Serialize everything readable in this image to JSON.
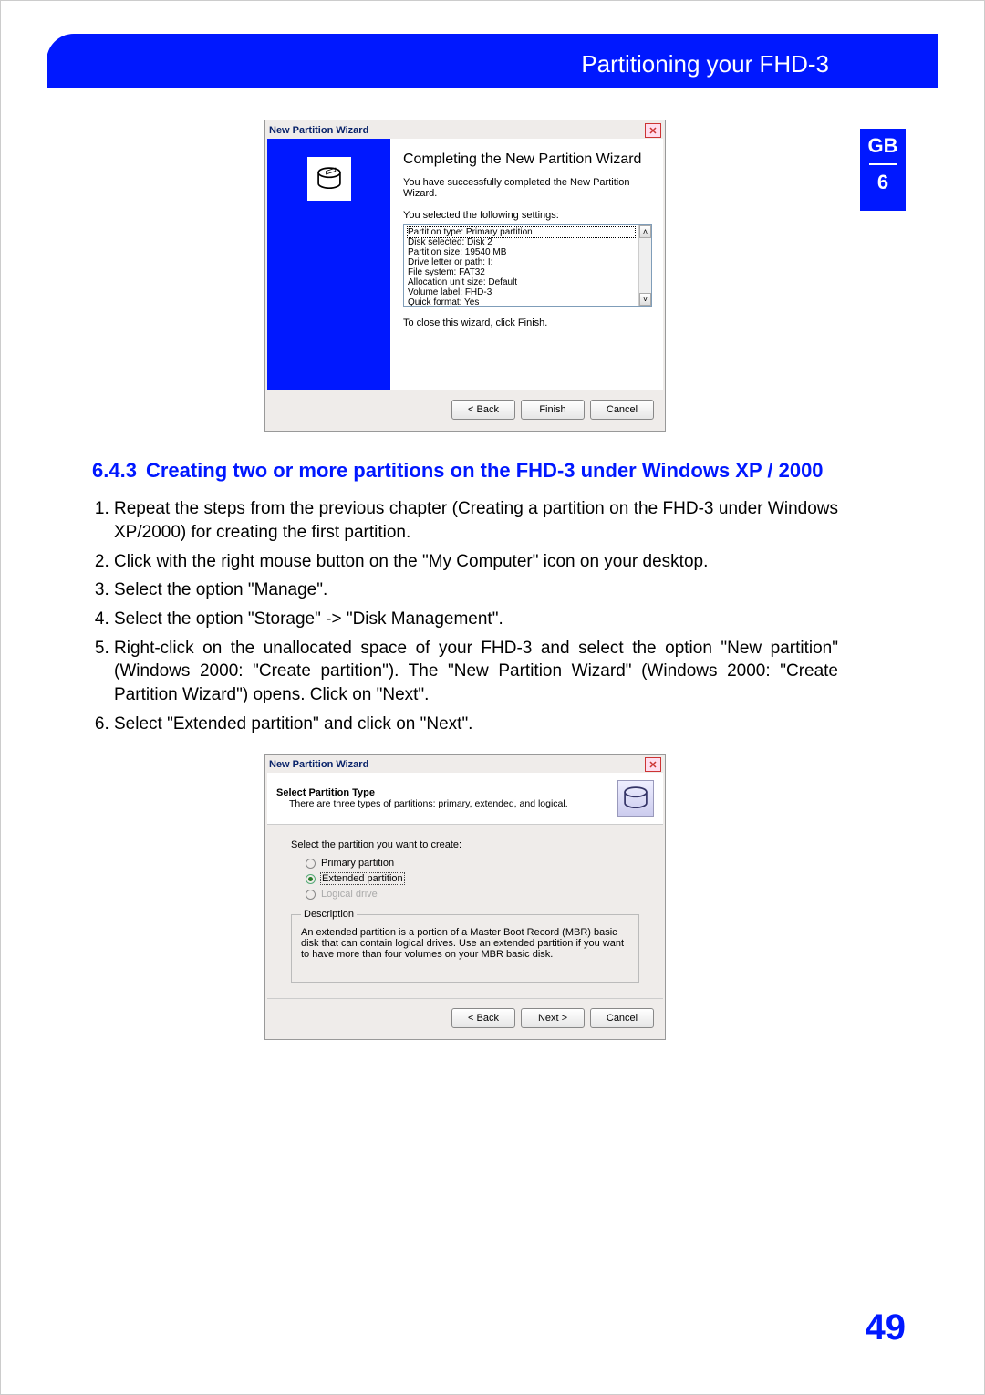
{
  "header": {
    "title": "Partitioning your FHD-3"
  },
  "side": {
    "lang": "GB",
    "chapter": "6"
  },
  "page_number": "49",
  "wizard1": {
    "window_title": "New Partition Wizard",
    "heading": "Completing the New Partition Wizard",
    "success_msg": "You have successfully completed the New Partition Wizard.",
    "selected_intro": "You selected the following settings:",
    "settings": [
      "Partition type: Primary partition",
      "Disk selected: Disk 2",
      "Partition size: 19540 MB",
      "Drive letter or path: I:",
      "File system: FAT32",
      "Allocation unit size: Default",
      "Volume label: FHD-3",
      "Quick format: Yes"
    ],
    "close_msg": "To close this wizard, click Finish.",
    "buttons": {
      "back": "< Back",
      "finish": "Finish",
      "cancel": "Cancel"
    }
  },
  "section": {
    "number": "6.4.3",
    "title": "Creating two or more partitions on the FHD-3 under Windows XP / 2000",
    "steps": [
      "Repeat the steps from the previous chapter (Creating a partition on the FHD-3 under Windows XP/2000) for creating the first partition.",
      "Click with the right mouse button on the \"My Computer\" icon on your desktop.",
      "Select the option \"Manage\".",
      "Select the option \"Storage\" -> \"Disk Management\".",
      "Right-click on the unallocated space of your FHD-3 and select the option \"New partition\" (Windows 2000: \"Create partition\"). The \"New Partition Wizard\" (Windows 2000: \"Create Partition Wizard\") opens. Click on \"Next\".",
      "Select \"Extended partition\" and click on \"Next\"."
    ]
  },
  "wizard2": {
    "window_title": "New Partition Wizard",
    "head_title": "Select Partition Type",
    "head_sub": "There are three types of partitions: primary, extended, and logical.",
    "prompt": "Select the partition you want to create:",
    "options": {
      "primary": "Primary partition",
      "extended": "Extended partition",
      "logical": "Logical drive"
    },
    "desc_legend": "Description",
    "desc_text": "An extended partition is a portion of a Master Boot Record (MBR) basic disk that can contain logical drives. Use an extended partition if you want to have more than four volumes on your MBR basic disk.",
    "buttons": {
      "back": "< Back",
      "next": "Next >",
      "cancel": "Cancel"
    }
  }
}
